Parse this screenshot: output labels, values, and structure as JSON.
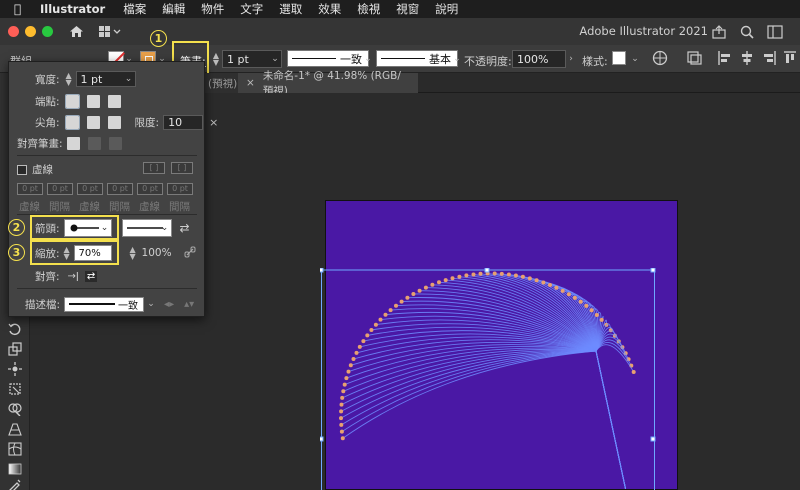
{
  "menubar": {
    "app_name": "Illustrator",
    "items": [
      "檔案",
      "編輯",
      "物件",
      "文字",
      "選取",
      "效果",
      "檢視",
      "視窗",
      "說明"
    ]
  },
  "titlebar": {
    "title": "Adobe Illustrator 2021"
  },
  "controlbar": {
    "selection_label": "群組",
    "stroke_label": "筆畫:",
    "stroke_weight": "1 pt",
    "profile_label": "一致",
    "brush_label": "基本",
    "opacity_label": "不透明度:",
    "opacity_value": "100%",
    "style_label": "樣式:"
  },
  "tabs": [
    {
      "label": "(預視)"
    },
    {
      "label": "未命名-1* @ 41.98% (RGB/預視)"
    }
  ],
  "stroke_panel": {
    "weight_label": "寬度:",
    "weight_value": "1 pt",
    "cap_label": "端點:",
    "corner_label": "尖角:",
    "limit_label": "限度:",
    "limit_value": "10",
    "align_label": "對齊筆畫:",
    "dashed_label": "虛線",
    "dash_fields": [
      {
        "value": "0 pt",
        "label": "虛線"
      },
      {
        "value": "0 pt",
        "label": "間隔"
      },
      {
        "value": "0 pt",
        "label": "虛線"
      },
      {
        "value": "0 pt",
        "label": "間隔"
      },
      {
        "value": "0 pt",
        "label": "虛線"
      },
      {
        "value": "0 pt",
        "label": "間隔"
      }
    ],
    "arrowheads_label": "箭頭:",
    "scale_label": "縮放:",
    "scale_start": "70%",
    "scale_end": "100%",
    "align_arrow_label": "對齊:",
    "profile_label": "描述檔:",
    "profile_value": "一致"
  },
  "annotations": [
    "1",
    "2",
    "3"
  ],
  "colors": {
    "artboard": "#4a18a5",
    "line": "#6f8cff",
    "dot": "#e8a070",
    "highlight": "#f4e04d"
  }
}
